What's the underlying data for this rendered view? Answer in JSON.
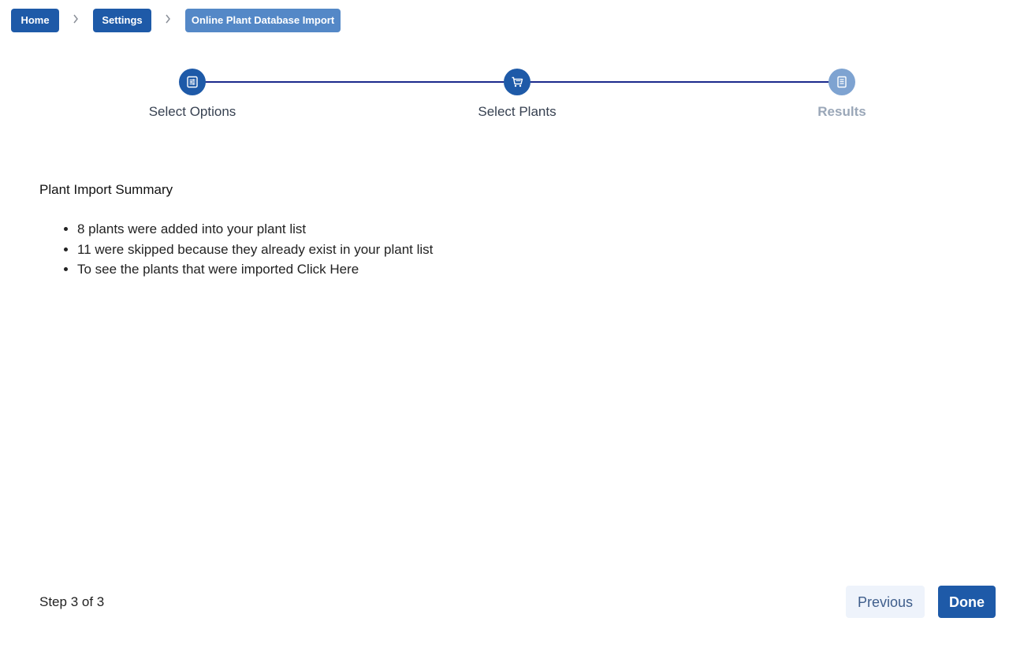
{
  "breadcrumb": {
    "items": [
      {
        "label": "Home"
      },
      {
        "label": "Settings"
      },
      {
        "label": "Online Plant Database Import"
      }
    ]
  },
  "stepper": {
    "steps": [
      {
        "label": "Select Options",
        "icon": "options-icon",
        "state": "complete"
      },
      {
        "label": "Select Plants",
        "icon": "cart-icon",
        "state": "complete"
      },
      {
        "label": "Results",
        "icon": "document-icon",
        "state": "pending"
      }
    ]
  },
  "summary": {
    "title": "Plant Import Summary",
    "items": [
      {
        "text": "8 plants were added into your plant list"
      },
      {
        "text": "11 were skipped because they already exist in your plant list"
      },
      {
        "text": "To see the plants that were imported",
        "link": "Click Here"
      }
    ]
  },
  "footer": {
    "step_text": "Step 3 of 3",
    "previous_label": "Previous",
    "done_label": "Done"
  },
  "colors": {
    "primary": "#1e5aa8",
    "breadcrumb_current": "#5488c7",
    "step_line": "#1b2a8c",
    "step_pending": "#7ea3d1",
    "previous_bg": "#eef3fb"
  }
}
